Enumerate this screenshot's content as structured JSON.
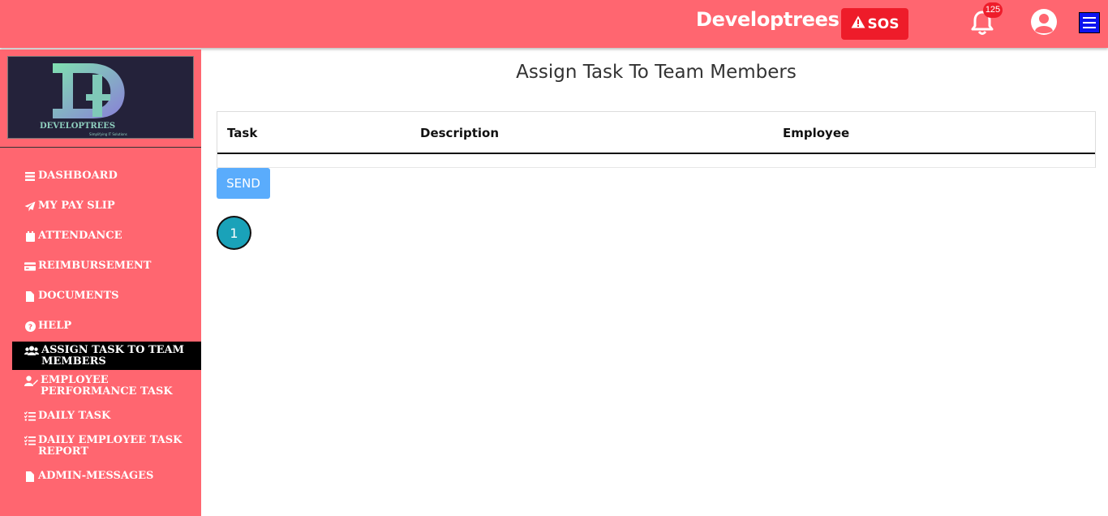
{
  "header": {
    "brand": "Developtrees",
    "sos_label": "SOS",
    "notification_count": "125",
    "colors": {
      "bar": "#ff6670",
      "sos": "#ee1c2a",
      "menu": "#0c12f0"
    }
  },
  "sidebar": {
    "logo_text": "DEVELOPTREES",
    "logo_tagline": "Simplifying IT Solutions",
    "items": [
      {
        "label": "DASHBOARD",
        "icon": "bars-icon"
      },
      {
        "label": "MY PAY SLIP",
        "icon": "paper-plane-icon"
      },
      {
        "label": "ATTENDANCE",
        "icon": "calendar-icon"
      },
      {
        "label": "REIMBURSEMENT",
        "icon": "credit-card-icon"
      },
      {
        "label": "DOCUMENTS",
        "icon": "file-icon"
      },
      {
        "label": "HELP",
        "icon": "question-circle-icon"
      },
      {
        "label": "ASSIGN TASK TO TEAM MEMBERS",
        "icon": "users-icon",
        "active": true
      },
      {
        "label": "EMPLOYEE PERFORMANCE TASK",
        "icon": "user-edit-icon"
      },
      {
        "label": "DAILY TASK",
        "icon": "tasks-icon"
      },
      {
        "label": "DAILY EMPLOYEE TASK REPORT",
        "icon": "tasks-icon"
      },
      {
        "label": "ADMIN-MESSAGES",
        "icon": "file-icon"
      }
    ]
  },
  "main": {
    "title": "Assign Task To Team Members",
    "table": {
      "columns": [
        "Task",
        "Description",
        "Employee"
      ]
    },
    "send_label": "SEND",
    "pagination": {
      "current_page": "1"
    }
  }
}
